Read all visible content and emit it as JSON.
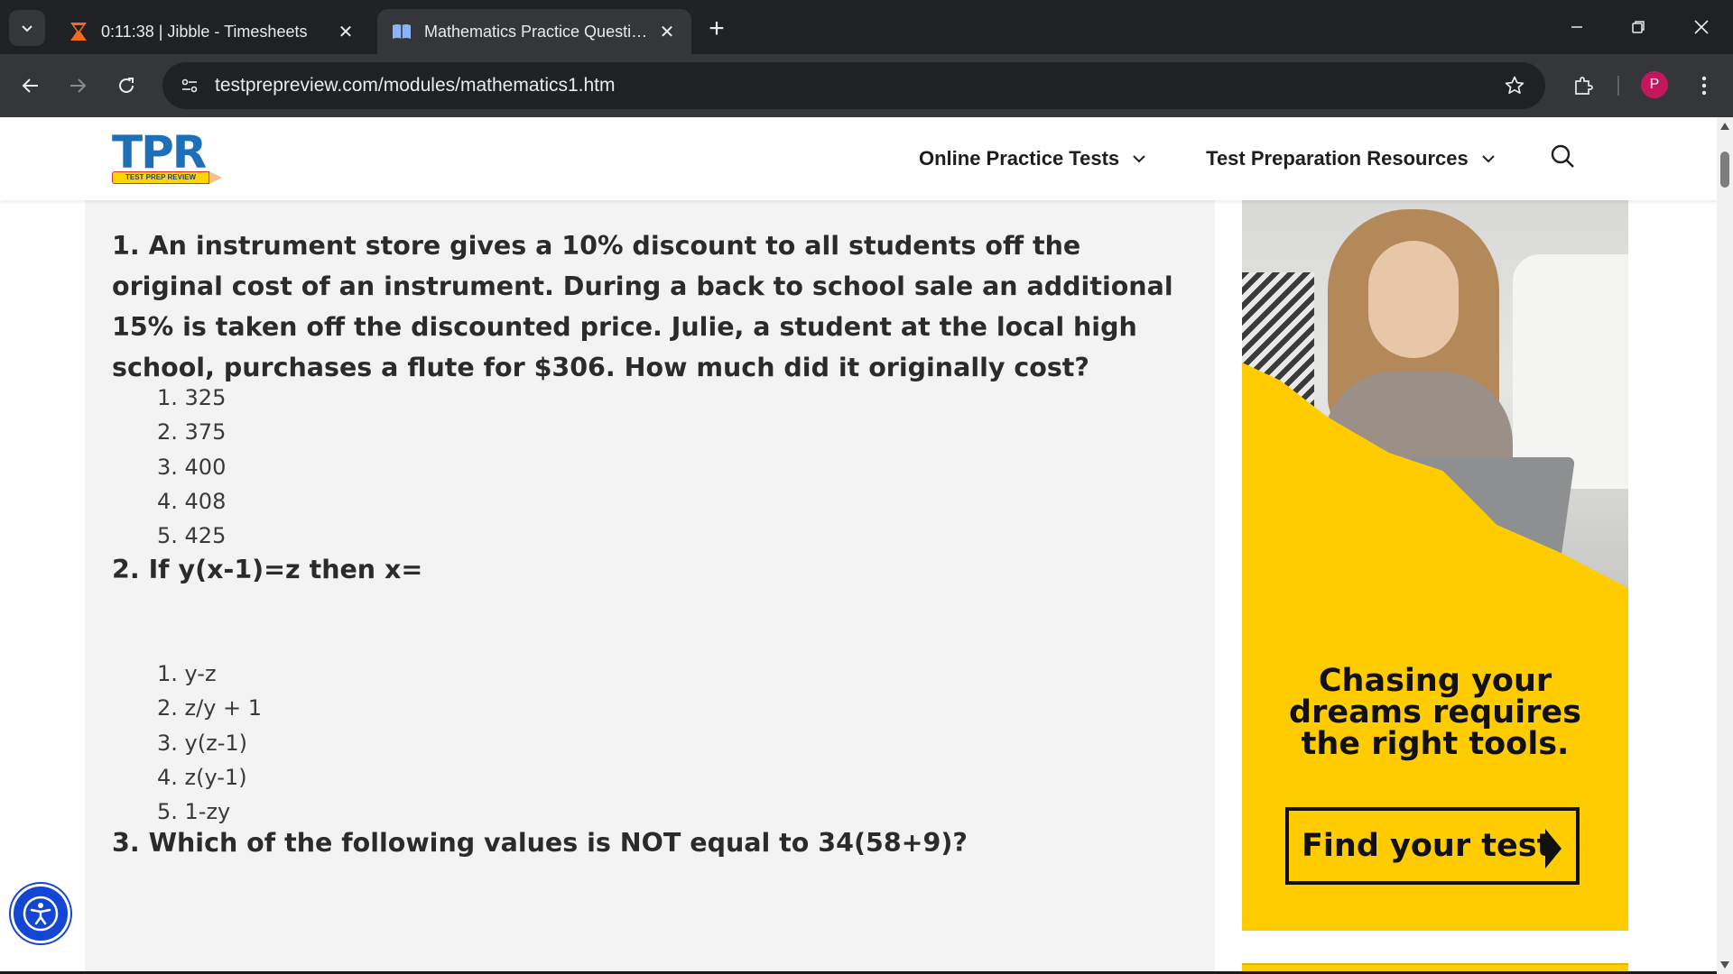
{
  "browser": {
    "tabs": [
      {
        "title": "0:11:38 | Jibble - Timesheets",
        "active": false,
        "favicon": "jibble-icon"
      },
      {
        "title": "Mathematics Practice Questions",
        "active": true,
        "favicon": "book-icon"
      }
    ],
    "url": "testprepreview.com/modules/mathematics1.htm",
    "profile_initial": "P"
  },
  "site": {
    "logo_text": "TPR",
    "logo_tagline": "TEST PREP REVIEW",
    "nav": [
      {
        "label": "Online Practice Tests"
      },
      {
        "label": "Test Preparation Resources"
      }
    ]
  },
  "questions": [
    {
      "text": "1. An instrument store gives a 10% discount to all students off the original cost of an instrument. During a back to school sale an additional 15% is taken off the discounted price. Julie, a student at the local high school, purchases a flute for $306. How much did it originally cost?",
      "answers": [
        "1. 325",
        "2. 375",
        "3. 400",
        "4. 408",
        "5. 425"
      ]
    },
    {
      "text": "2. If y(x-1)=z then x=",
      "answers": [
        "1. y-z",
        "2. z/y + 1",
        "3. y(z-1)",
        "4. z(y-1)",
        "5. 1-zy"
      ]
    },
    {
      "text": "3. Which of the following values is NOT equal to 34(58+9)?",
      "answers": []
    }
  ],
  "ad": {
    "headline_lines": [
      "Chasing your",
      "dreams requires",
      "the right tools."
    ],
    "cta": "Find your test",
    "bg_color": "#ffcc00"
  },
  "colors": {
    "brand_blue": "#1d70b8",
    "chrome_dark": "#202124",
    "chrome_mid": "#35363a",
    "content_bg": "#f3f3f3",
    "accessibility_blue": "#1446d6"
  }
}
